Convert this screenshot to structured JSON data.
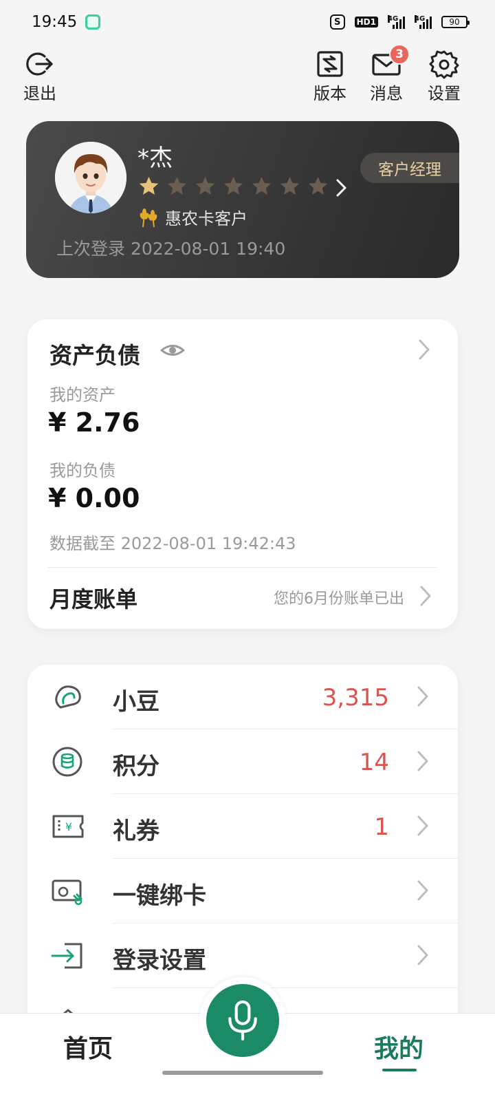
{
  "status_bar": {
    "time": "19:45",
    "shield": "S",
    "hd": "HD1",
    "net1": "4G",
    "net2": "4G",
    "battery": "90"
  },
  "top_actions": {
    "logout": "退出",
    "version": "版本",
    "messages": "消息",
    "messages_badge": "3",
    "settings": "设置"
  },
  "profile": {
    "name": "*杰",
    "rating": 1,
    "rating_max": 7,
    "manager_button": "客户经理",
    "tier": "惠农卡客户",
    "last_login": "上次登录 2022-08-01 19:40"
  },
  "assets": {
    "title": "资产负债",
    "assets_label": "我的资产",
    "assets_value": "¥ 2.76",
    "liabilities_label": "我的负债",
    "liabilities_value": "¥ 0.00",
    "data_date": "数据截至 2022-08-01 19:42:43",
    "bill_title": "月度账单",
    "bill_status": "您的6月份账单已出"
  },
  "benefits": [
    {
      "label": "小豆",
      "value": "3,315",
      "icon": "bean-icon"
    },
    {
      "label": "积分",
      "value": "14",
      "icon": "points-coin-icon"
    },
    {
      "label": "礼券",
      "value": "1",
      "icon": "coupon-icon"
    },
    {
      "label": "一键绑卡",
      "value": "",
      "icon": "bind-card-icon"
    },
    {
      "label": "登录设置",
      "value": "",
      "icon": "login-settings-icon"
    }
  ],
  "bottom_nav": {
    "home": "首页",
    "mine": "我的"
  },
  "colors": {
    "accent_green": "#1b8a67",
    "value_red": "#d9534f",
    "gold": "#e9cfa2"
  }
}
